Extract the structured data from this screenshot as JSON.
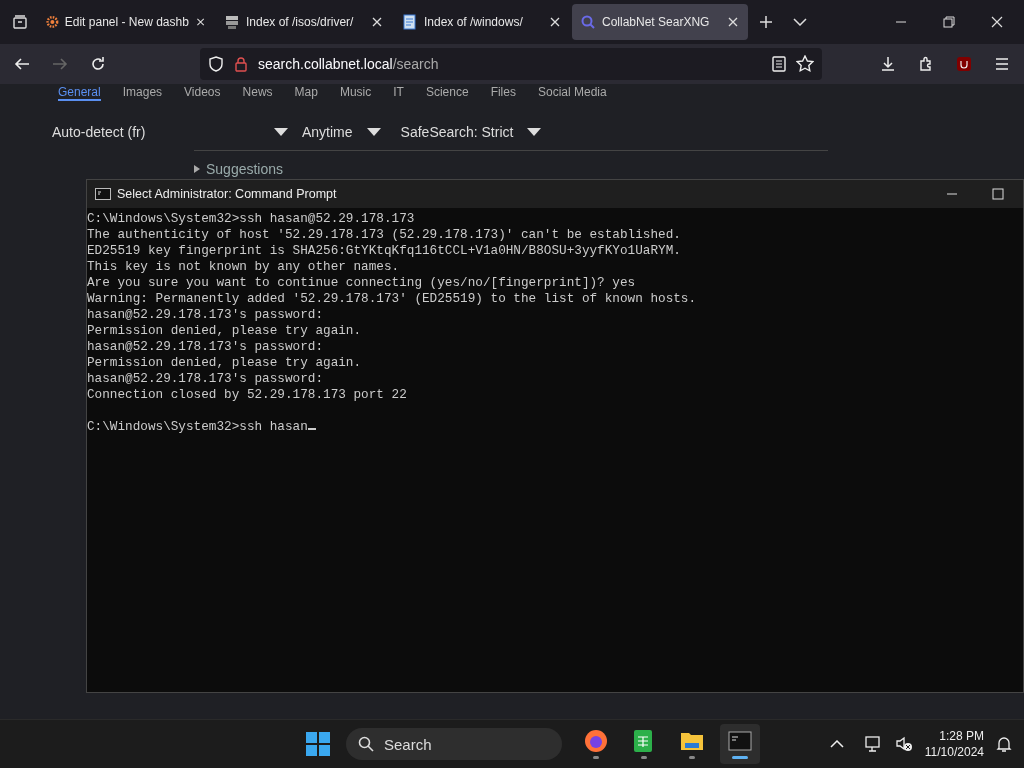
{
  "browser": {
    "tabs": [
      {
        "title": "Edit panel - New dashb",
        "selected": false
      },
      {
        "title": "Index of /isos/driver/",
        "selected": false
      },
      {
        "title": "Index of /windows/",
        "selected": false
      },
      {
        "title": "CollabNet SearXNG",
        "selected": true
      }
    ],
    "url_host": "search.collabnet.local",
    "url_path": "/search"
  },
  "search_page": {
    "categories": [
      {
        "label": "General",
        "selected": true
      },
      {
        "label": "Images",
        "selected": false
      },
      {
        "label": "Videos",
        "selected": false
      },
      {
        "label": "News",
        "selected": false
      },
      {
        "label": "Map",
        "selected": false
      },
      {
        "label": "Music",
        "selected": false
      },
      {
        "label": "IT",
        "selected": false
      },
      {
        "label": "Science",
        "selected": false
      },
      {
        "label": "Files",
        "selected": false
      },
      {
        "label": "Social Media",
        "selected": false
      }
    ],
    "filters": [
      "Auto-detect (fr)",
      "Anytime",
      "SafeSearch: Strict"
    ],
    "suggestions": "Suggestions"
  },
  "terminal": {
    "title": "Select Administrator: Command Prompt",
    "lines": [
      "C:\\Windows\\System32>ssh hasan@52.29.178.173",
      "The authenticity of host '52.29.178.173 (52.29.178.173)' can't be established.",
      "ED25519 key fingerprint is SHA256:GtYKtqKfq116tCCL+V1a0HN/B8OSU+3yyfKYo1UaRYM.",
      "This key is not known by any other names.",
      "Are you sure you want to continue connecting (yes/no/[fingerprint])? yes",
      "Warning: Permanently added '52.29.178.173' (ED25519) to the list of known hosts.",
      "hasan@52.29.178.173's password:",
      "Permission denied, please try again.",
      "hasan@52.29.178.173's password:",
      "Permission denied, please try again.",
      "hasan@52.29.178.173's password:",
      "Connection closed by 52.29.178.173 port 22"
    ],
    "prompt": "C:\\Windows\\System32>ssh hasan",
    "cursor": true
  },
  "taskbar": {
    "search": "Search",
    "apps": [
      {
        "running": true,
        "active": false
      },
      {
        "running": true,
        "active": false
      },
      {
        "running": true,
        "active": false
      },
      {
        "running": true,
        "active": true
      }
    ],
    "time": "1:28 PM",
    "date": "11/10/2024"
  }
}
